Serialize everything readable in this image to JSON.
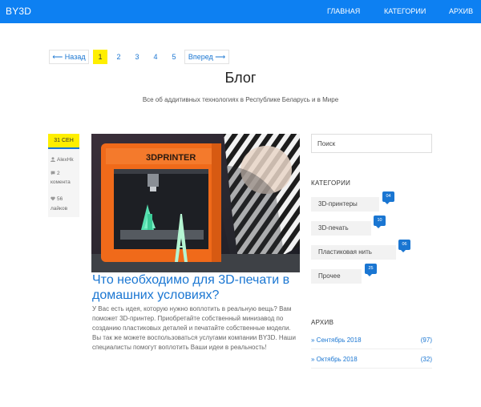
{
  "navbar": {
    "brand": "BY3D",
    "links": [
      "ГЛАВНАЯ",
      "КАТЕГОРИИ",
      "АРХИВ"
    ]
  },
  "pagination": {
    "prev": "⟵ Назад",
    "pages": [
      "1",
      "2",
      "3",
      "4",
      "5"
    ],
    "current": "1",
    "next": "Вперед ⟶"
  },
  "header": {
    "title": "Блог",
    "subtitle": "Все об аддитивных технологиях в Республике Беларусь и в Мире"
  },
  "post": {
    "date": "31 СЕН",
    "author": "AlexHk",
    "comments_count": "2",
    "comments_label": "комента",
    "likes_count": "56",
    "likes_label": "лайков",
    "image_text": "3DPRINTER",
    "title": "Что необходимо для 3D-печати в домашних условиях?",
    "excerpt": "У Вас есть идея, которую нужно воплотить в реальную вещь? Вам поможет 3D-принтер. Приобретайте собственный минизавод по созданию пластиковых деталей и печатайте собственные модели. Вы так же можете воспользоваться услугами компании BY3D. Наши специалисты помогут воплотить Ваши идеи в реальность!"
  },
  "sidebar": {
    "search_placeholder": "Поиск",
    "categories_heading": "КАТЕГОРИИ",
    "categories": [
      {
        "label": "3D-принтеры",
        "count": "04"
      },
      {
        "label": "3D-печать",
        "count": "10"
      },
      {
        "label": "Пластиковая нить",
        "count": "06"
      },
      {
        "label": "Прочее",
        "count": "25"
      }
    ],
    "archive_heading": "АРХИВ",
    "archive": [
      {
        "label": "» Сентябрь 2018",
        "count": "(97)"
      },
      {
        "label": "» Октябрь 2018",
        "count": "(32)"
      }
    ]
  },
  "colors": {
    "brand_blue": "#0d80f2",
    "link_blue": "#1a76d2",
    "highlight_yellow": "#ffef00",
    "printer_orange": "#f06a1a"
  }
}
